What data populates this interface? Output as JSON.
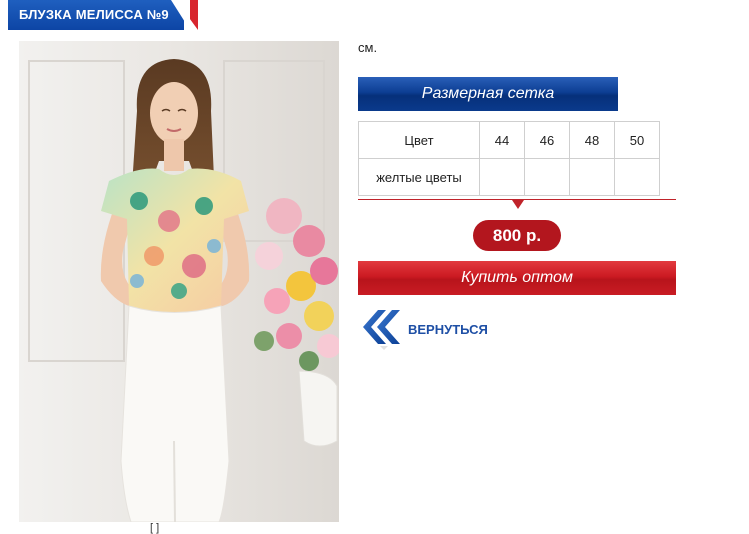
{
  "product": {
    "title": "БЛУЗКА МЕЛИССА №9",
    "unit_text": "см.",
    "caption_fragment": "[ ]"
  },
  "size_chart": {
    "button_label": "Размерная сетка",
    "header": [
      "Цвет",
      "44",
      "46",
      "48",
      "50"
    ],
    "rows": [
      [
        "желтые цветы",
        "",
        "",
        "",
        ""
      ]
    ]
  },
  "price": {
    "label": "800 р."
  },
  "actions": {
    "buy_label": "Купить оптом",
    "back_label": "ВЕРНУТЬСЯ"
  },
  "colors": {
    "accent_blue": "#0d45a5",
    "accent_red": "#c0232a",
    "link_blue": "#1e4fa5"
  },
  "icons": {
    "back": "double-chevron-left-icon"
  }
}
